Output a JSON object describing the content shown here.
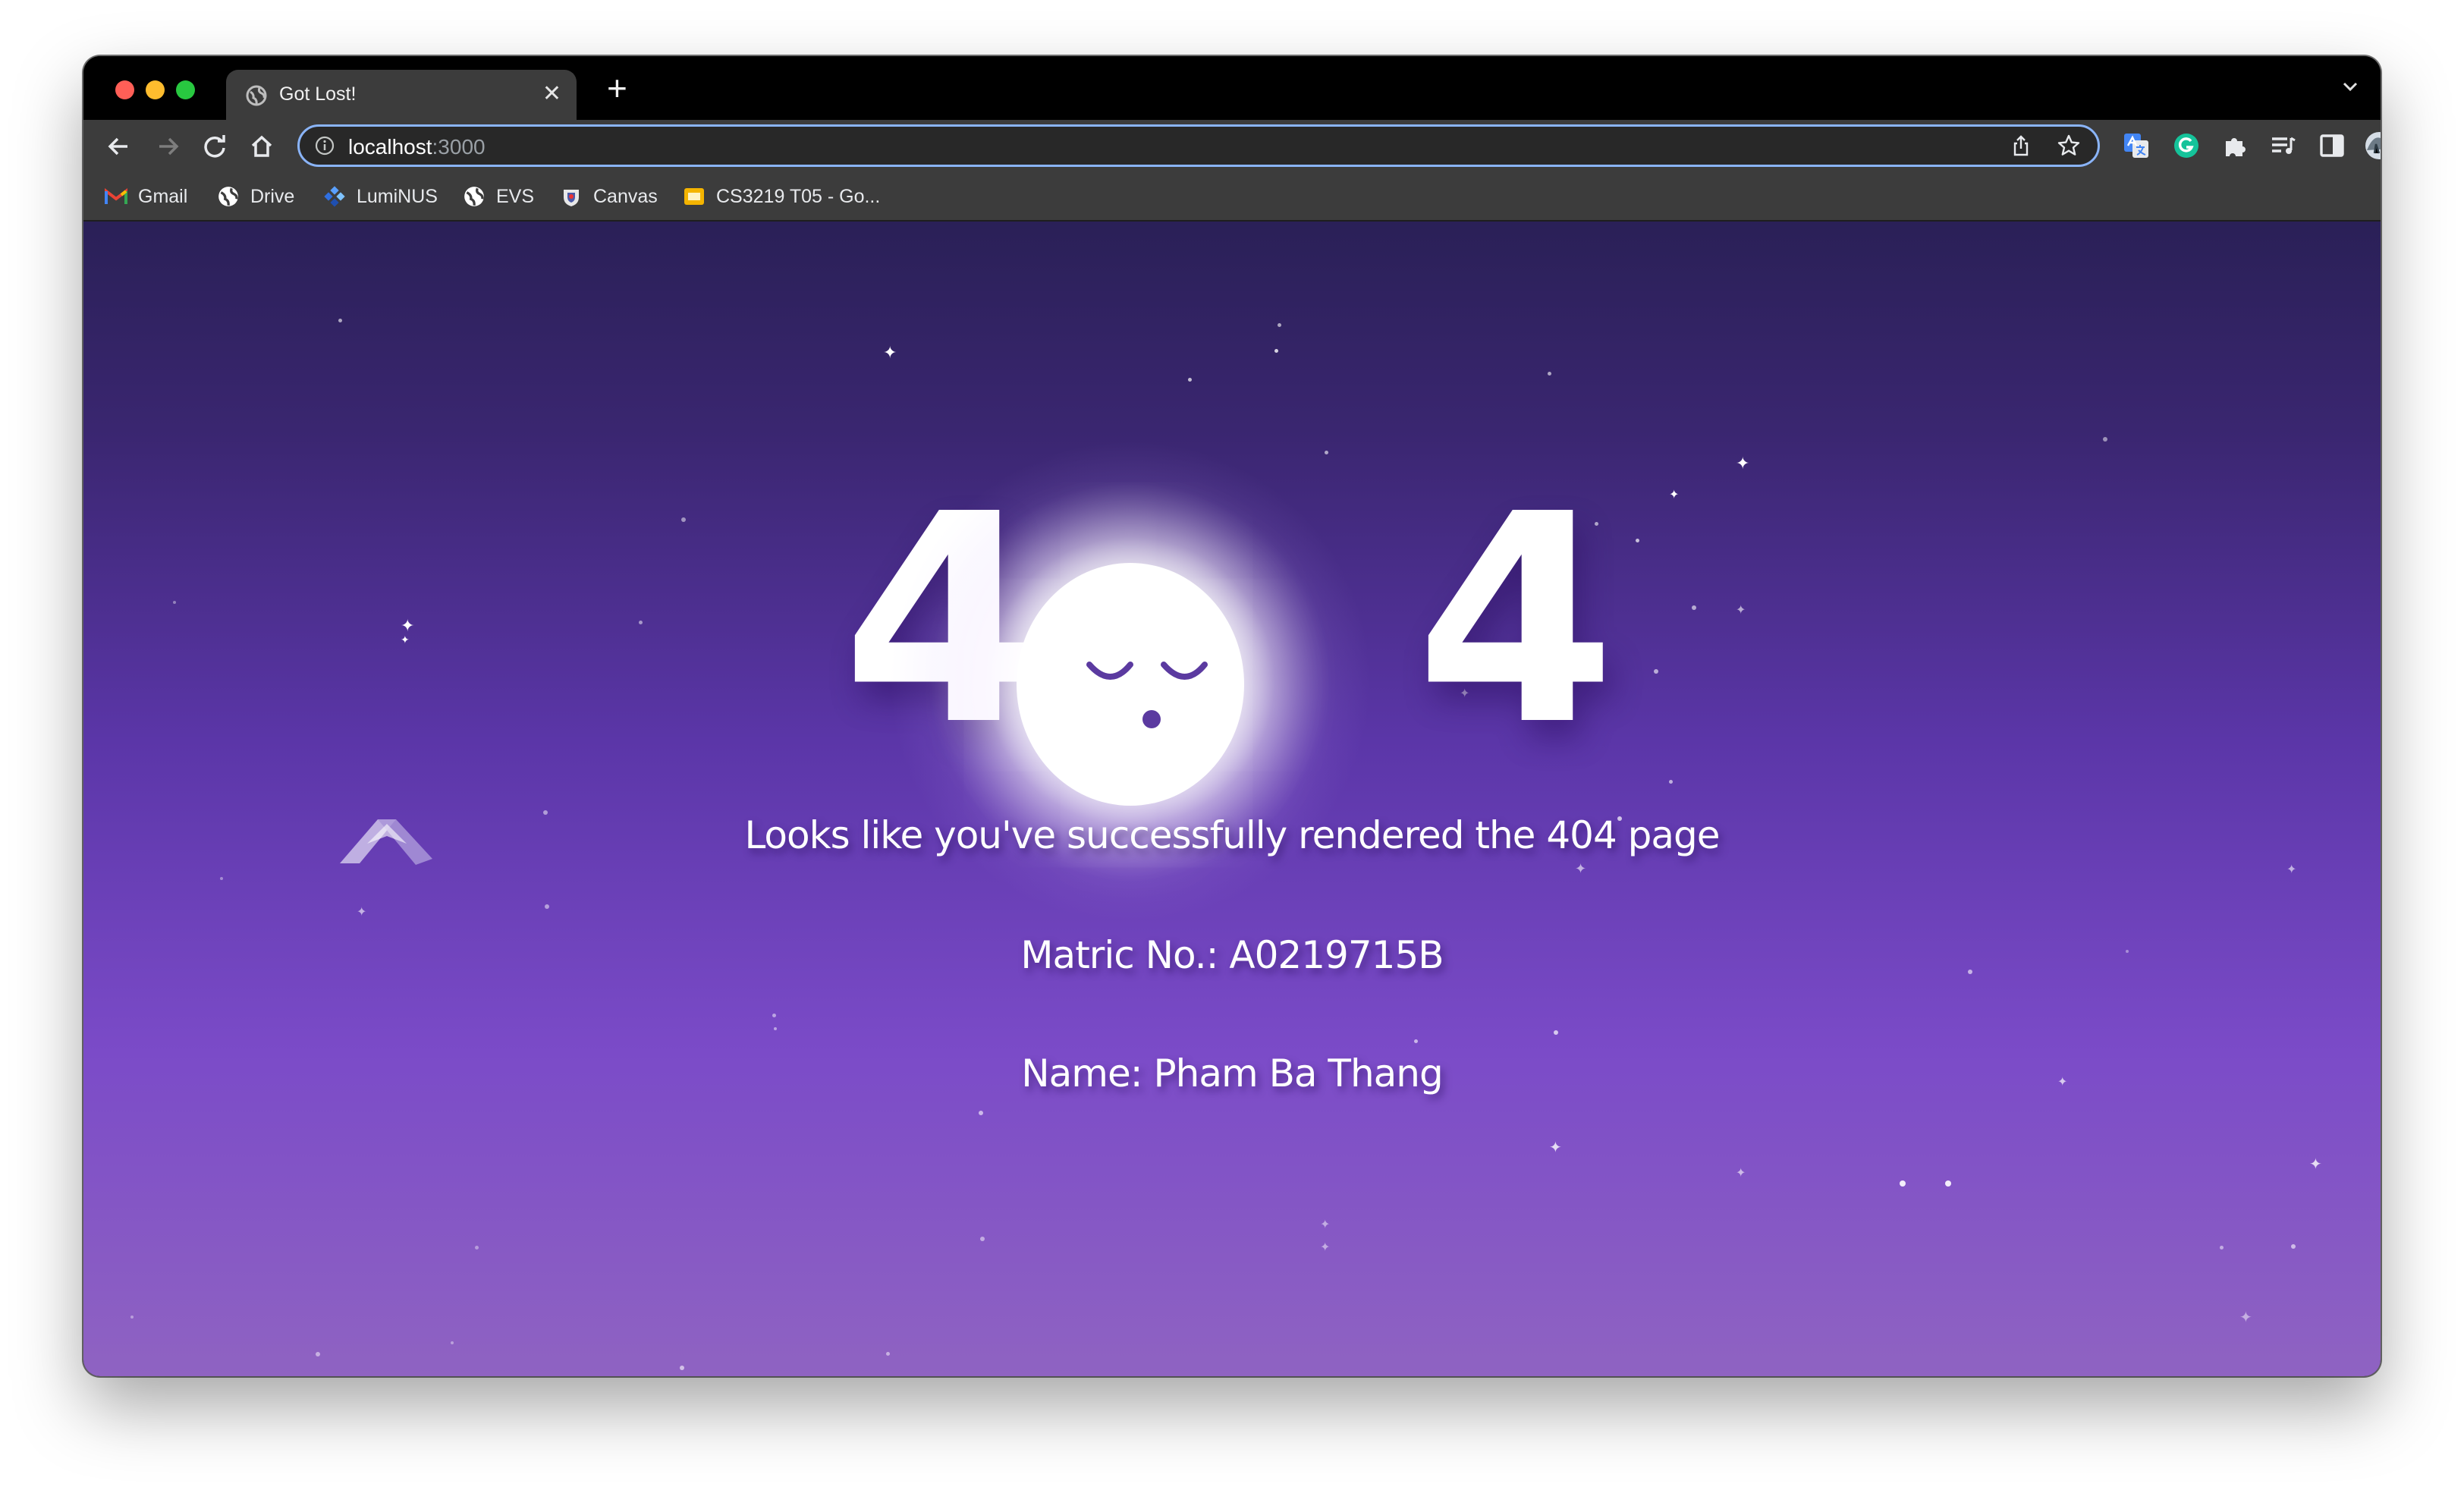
{
  "browser": {
    "tab_title": "Got Lost!",
    "new_tab_symbol": "+",
    "close_symbol": "✕",
    "url_host": "localhost",
    "url_port": ":3000"
  },
  "bookmarks": [
    {
      "label": "Gmail",
      "icon": "gmail-icon"
    },
    {
      "label": "Drive",
      "icon": "globe-icon"
    },
    {
      "label": "LumiNUS",
      "icon": "luminus-icon"
    },
    {
      "label": "EVS",
      "icon": "globe-icon"
    },
    {
      "label": "Canvas",
      "icon": "canvas-icon"
    },
    {
      "label": "CS3219 T05 - Go...",
      "icon": "slides-icon"
    }
  ],
  "page": {
    "digit_left": "4",
    "digit_right": "4",
    "message": "Looks like you've successfully rendered the 404 page",
    "matric": "Matric No.: A0219715B",
    "name": "Name: Pham Ba Thang"
  },
  "colors": {
    "page_top": "#2a2057",
    "page_mid": "#7b4bc8",
    "page_bottom": "#8f63c2",
    "omnibox_border": "#8ab4f8"
  }
}
